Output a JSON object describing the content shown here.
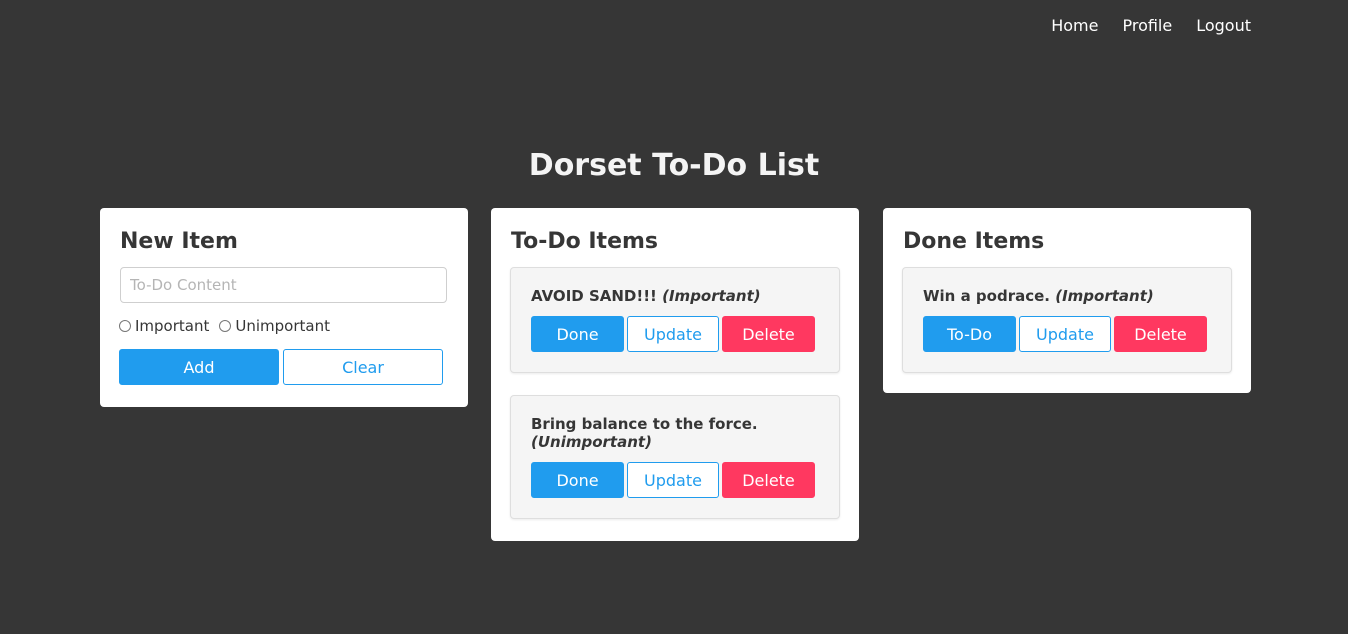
{
  "nav": {
    "home": "Home",
    "profile": "Profile",
    "logout": "Logout"
  },
  "page": {
    "title": "Dorset To-Do List"
  },
  "new_item": {
    "heading": "New Item",
    "input_placeholder": "To-Do Content",
    "input_value": "",
    "radio_important": "Important",
    "radio_unimportant": "Unimportant",
    "add_label": "Add",
    "clear_label": "Clear"
  },
  "todo": {
    "heading": "To-Do Items",
    "items": [
      {
        "text": "AVOID SAND!!!",
        "priority": "(Important)",
        "done_label": "Done",
        "update_label": "Update",
        "delete_label": "Delete"
      },
      {
        "text": "Bring balance to the force.",
        "priority": "(Unimportant)",
        "done_label": "Done",
        "update_label": "Update",
        "delete_label": "Delete"
      }
    ]
  },
  "done": {
    "heading": "Done Items",
    "items": [
      {
        "text": "Win a podrace.",
        "priority": "(Important)",
        "todo_label": "To-Do",
        "update_label": "Update",
        "delete_label": "Delete"
      }
    ]
  },
  "colors": {
    "background": "#363636",
    "primary": "#209cee",
    "danger": "#ff3860"
  }
}
